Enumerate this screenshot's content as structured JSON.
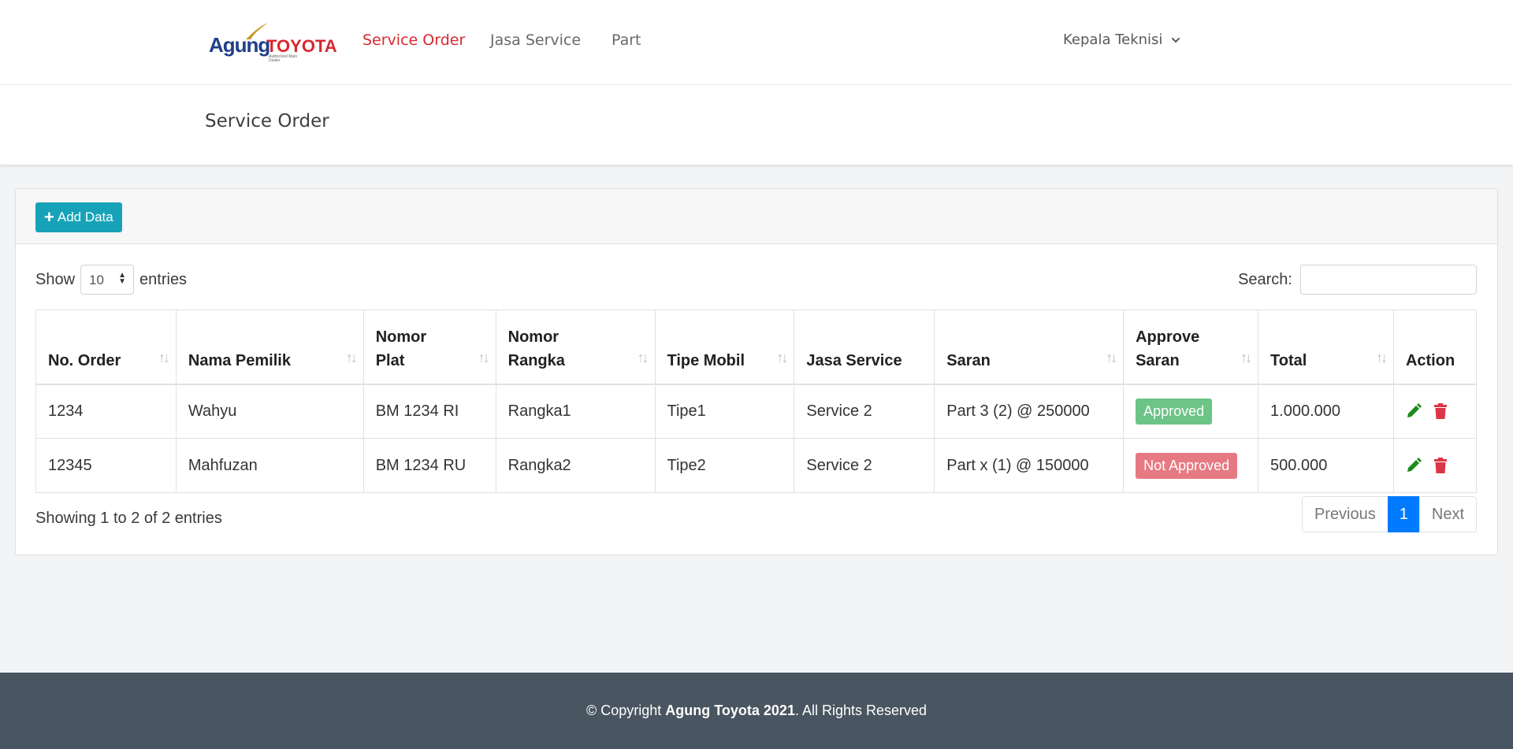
{
  "brand": {
    "logo_text_1": "Agung",
    "logo_text_2": "TOYOTA",
    "logo_sub": "Authorized Main Dealer"
  },
  "nav": {
    "items": [
      {
        "label": "Service Order",
        "active": true
      },
      {
        "label": "Jasa Service",
        "active": false
      },
      {
        "label": "Part",
        "active": false
      }
    ],
    "user": "Kepala Teknisi"
  },
  "page": {
    "title": "Service Order"
  },
  "card": {
    "add_button": "Add Data",
    "length": {
      "before": "Show",
      "value": "10",
      "after": "entries"
    },
    "search_label": "Search:",
    "search_value": ""
  },
  "table": {
    "headers": [
      {
        "line1": "",
        "line2": "No. Order",
        "sortable": true
      },
      {
        "line1": "",
        "line2": "Nama Pemilik",
        "sortable": true
      },
      {
        "line1": "Nomor",
        "line2": "Plat",
        "sortable": true
      },
      {
        "line1": "Nomor",
        "line2": "Rangka",
        "sortable": true
      },
      {
        "line1": "",
        "line2": "Tipe Mobil",
        "sortable": true
      },
      {
        "line1": "",
        "line2": "Jasa Service",
        "sortable": false
      },
      {
        "line1": "",
        "line2": "Saran",
        "sortable": true
      },
      {
        "line1": "Approve",
        "line2": "Saran",
        "sortable": true
      },
      {
        "line1": "",
        "line2": "Total",
        "sortable": true
      },
      {
        "line1": "",
        "line2": "Action",
        "sortable": false
      }
    ],
    "rows": [
      {
        "no_order": "1234",
        "nama_pemilik": "Wahyu",
        "nomor_plat": "BM 1234 RI",
        "nomor_rangka": "Rangka1",
        "tipe_mobil": "Tipe1",
        "jasa_service": "Service 2",
        "saran": "Part 3 (2) @ 250000",
        "approve": "Approved",
        "total": "1.000.000"
      },
      {
        "no_order": "12345",
        "nama_pemilik": "Mahfuzan",
        "nomor_plat": "BM 1234 RU",
        "nomor_rangka": "Rangka2",
        "tipe_mobil": "Tipe2",
        "jasa_service": "Service 2",
        "saran": "Part x (1) @ 150000",
        "approve": "Not Approved",
        "total": "500.000"
      }
    ],
    "info": "Showing 1 to 2 of 2 entries"
  },
  "pagination": {
    "previous": "Previous",
    "current": "1",
    "next": "Next"
  },
  "footer": {
    "prefix": "© Copyright ",
    "brand": "Agung Toyota 2021",
    "suffix": ". All Rights Reserved"
  },
  "colors": {
    "accent_red": "#d7282f",
    "add_button": "#17a2b8",
    "approved": "#6cc487",
    "not_approved": "#e67a83",
    "edit_icon": "#1e8a1e",
    "delete_icon": "#dc3545",
    "page_active": "#007bff",
    "footer_bg": "#495560"
  }
}
